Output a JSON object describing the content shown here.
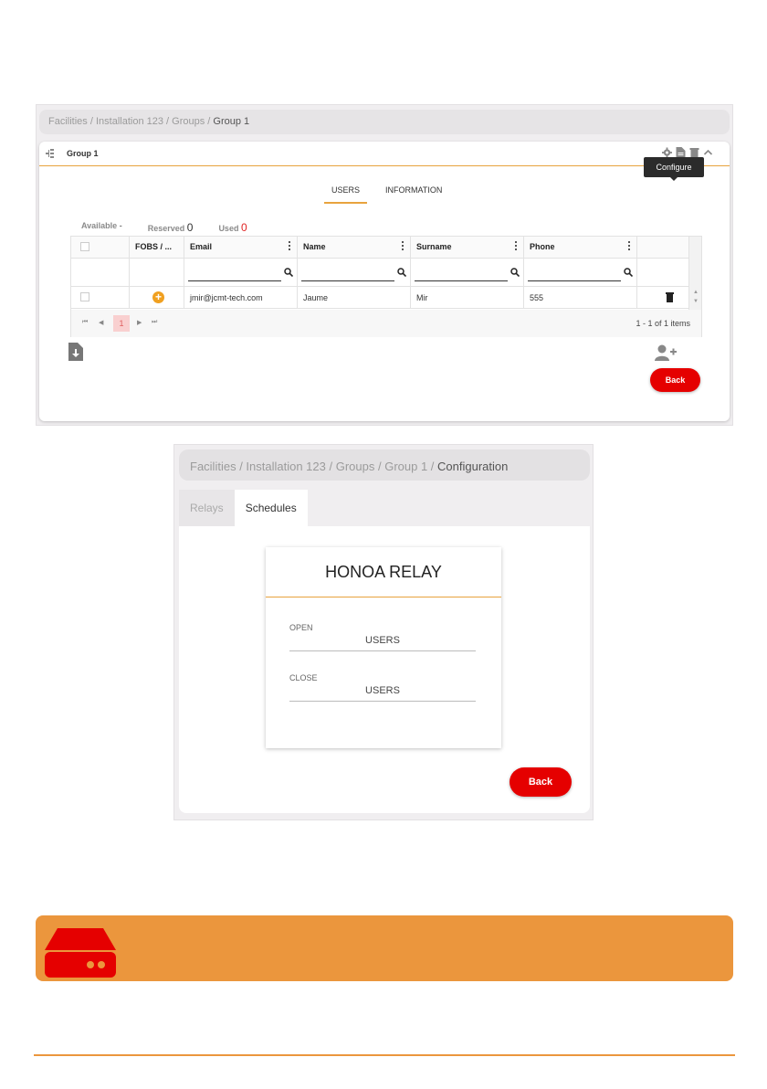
{
  "screen1": {
    "breadcrumb": {
      "parts": [
        "Facilities",
        "Installation 123",
        "Groups"
      ],
      "sep": " / ",
      "current": "Group 1"
    },
    "card_title": "Group 1",
    "tooltip": "Configure",
    "tabs": [
      {
        "label": "USERS",
        "active": true
      },
      {
        "label": "INFORMATION",
        "active": false
      }
    ],
    "counters": {
      "available_label": "Available",
      "available_value": "-",
      "reserved_label": "Reserved",
      "reserved_value": "0",
      "used_label": "Used",
      "used_value": "0"
    },
    "table": {
      "columns": [
        "FOBS / ...",
        "Email",
        "Name",
        "Surname",
        "Phone"
      ],
      "rows": [
        {
          "email": "jmir@jcmt-tech.com",
          "name": "Jaume",
          "surname": "Mir",
          "phone": "555"
        }
      ]
    },
    "pager": {
      "current_page": "1",
      "info": "1 - 1 of 1 items"
    },
    "back_label": "Back"
  },
  "screen2": {
    "breadcrumb": {
      "parts": [
        "Facilities",
        "Installation 123",
        "Groups",
        "Group 1"
      ],
      "sep": " / ",
      "current": "Configuration"
    },
    "tabs": [
      {
        "label": "Relays",
        "active": false
      },
      {
        "label": "Schedules",
        "active": true
      }
    ],
    "relay_title": "HONOA RELAY",
    "fields": [
      {
        "label": "OPEN",
        "value": "USERS"
      },
      {
        "label": "CLOSE",
        "value": "USERS"
      }
    ],
    "back_label": "Back"
  },
  "colors": {
    "accent": "#eb963d",
    "danger": "#e50000",
    "orange_plus": "#f0a020"
  }
}
